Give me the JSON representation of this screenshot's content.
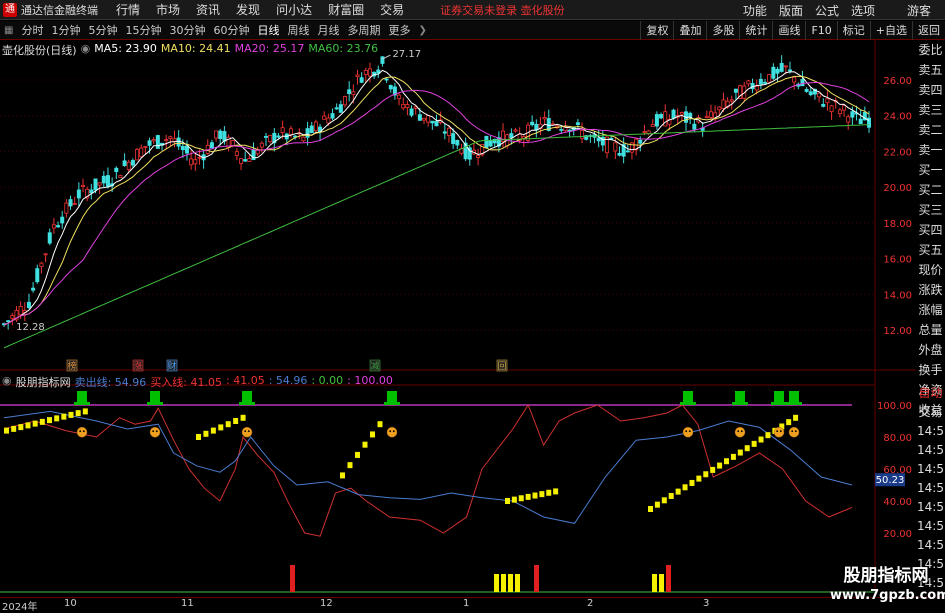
{
  "menubar": {
    "app_title": "通达信金融终端",
    "items": [
      "行情",
      "市场",
      "资讯",
      "发现",
      "问小达",
      "财富圈",
      "交易"
    ],
    "notice": "证券交易未登录  壶化股份",
    "right_items": [
      "功能",
      "版面",
      "公式",
      "选项"
    ],
    "guest": "游客"
  },
  "toolbar": {
    "periods": [
      "分时",
      "1分钟",
      "5分钟",
      "15分钟",
      "30分钟",
      "60分钟",
      "日线",
      "周线",
      "月线",
      "多周期",
      "更多"
    ],
    "active_period": "日线",
    "right_buttons": [
      "复权",
      "叠加",
      "多股",
      "统计",
      "画线",
      "F10",
      "标记",
      "+自选",
      "返回"
    ]
  },
  "main_legend": {
    "stock": "壶化股份(日线)",
    "ma5": "MA5: 23.90",
    "ma10": "MA10: 24.41",
    "ma20": "MA20: 25.17",
    "ma60": "MA60: 23.76"
  },
  "ind_legend": {
    "name": "股朋指标网",
    "sell_line": "卖出线: 54.96",
    "buy_line": "买入线: 41.05",
    "v1": ": 41.05",
    "v2": ": 54.96",
    "v3": ": 0.00",
    "v4": ": 100.00"
  },
  "price_axis": {
    "labels": [
      "26.00",
      "24.00",
      "22.00",
      "20.00",
      "18.00",
      "16.00",
      "14.00",
      "12.00"
    ],
    "values": [
      26,
      24,
      22,
      20,
      18,
      16,
      14,
      12
    ],
    "high_label": "27.17",
    "low_label": "12.28",
    "current_tag": "50.23"
  },
  "ind_axis": {
    "labels": [
      "100.00",
      "80.00",
      "60.00",
      "40.00",
      "20.00"
    ],
    "values": [
      100,
      80,
      60,
      40,
      20
    ]
  },
  "event_markers": [
    {
      "text": "榜",
      "color": "#d48a3a"
    },
    {
      "text": "涨",
      "color": "#e33"
    },
    {
      "text": "财",
      "color": "#4a9cf0"
    },
    {
      "text": "减",
      "color": "#3a9c3a"
    },
    {
      "text": "回",
      "color": "#c8a040"
    }
  ],
  "right_panel": {
    "items": [
      "委比",
      "卖五",
      "卖四",
      "卖三",
      "卖二",
      "卖一",
      "买一",
      "买二",
      "买三",
      "买四",
      "买五",
      "现价",
      "涨跌",
      "涨幅",
      "总量",
      "外盘",
      "换手",
      "净资",
      "收益"
    ],
    "items2": [
      "自动",
      "交易",
      "14:5",
      "14:5",
      "14:5",
      "14:5",
      "14:5",
      "14:5",
      "14:5",
      "14:5",
      "14:5",
      "14:5"
    ]
  },
  "date_axis": {
    "labels": [
      "2024年",
      "10",
      "11",
      "12",
      "1",
      "2",
      "3"
    ]
  },
  "watermark": {
    "line1": "股朋指标网",
    "line2": "www.7gpzb.com"
  },
  "colors": {
    "ma5": "#ffffff",
    "ma10": "#f0e060",
    "ma20": "#e040e0",
    "ma60": "#40c040",
    "up": "#e33",
    "down": "#40e0e0",
    "sell_line": "#4a7cd0",
    "buy_line": "#d03030"
  }
}
